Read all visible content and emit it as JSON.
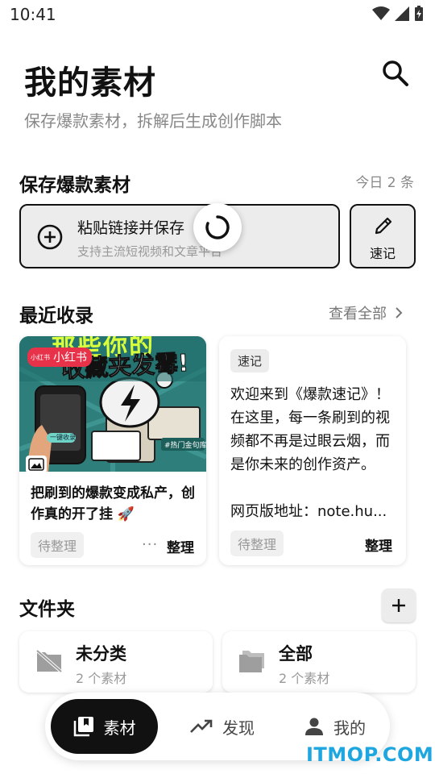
{
  "status_bar": {
    "time": "10:41"
  },
  "header": {
    "title": "我的素材",
    "subtitle": "保存爆款素材，拆解后生成创作脚本"
  },
  "save_section": {
    "title": "保存爆款素材",
    "today_count": "今日 2 条",
    "paste_title": "粘贴链接并保存",
    "paste_subtitle": "支持主流短视频和文章平台",
    "quick_note_label": "速记"
  },
  "recent_section": {
    "title": "最近收录",
    "view_all": "查看全部",
    "cards": [
      {
        "cover_badge_small": "小红书",
        "cover_badge": "小红书",
        "cover_headline_top": "那些你的",
        "cover_headline": "收藏夹发霉!",
        "cover_button": "一键收录",
        "cover_tag": "#热门金句库",
        "title": "把刷到的爆款变成私产，创作真的开了挂 🚀",
        "status": "待整理",
        "more": "···",
        "action": "整理"
      },
      {
        "tag": "速记",
        "body": "欢迎来到《爆款速记》！在这里，每一条刷到的视频都不再是过眼云烟，而是你未来的创作资产。",
        "url": "网页版地址：note.hu...",
        "status": "待整理",
        "action": "整理"
      }
    ]
  },
  "folder_section": {
    "title": "文件夹",
    "folders": [
      {
        "name": "未分类",
        "count": "2 个素材",
        "icon": "folder-off-icon"
      },
      {
        "name": "全部",
        "count": "2 个素材",
        "icon": "folder-icon"
      }
    ]
  },
  "bottom_nav": {
    "items": [
      {
        "label": "素材",
        "icon": "library-icon",
        "active": true
      },
      {
        "label": "发现",
        "icon": "trending-icon",
        "active": false
      },
      {
        "label": "我的",
        "icon": "person-icon",
        "active": false
      }
    ]
  },
  "watermark": "ITMOP.COM",
  "colors": {
    "accent": "#111111",
    "muted": "#888888",
    "card_bg": "#ececec",
    "watermark": "#1da6e0"
  }
}
